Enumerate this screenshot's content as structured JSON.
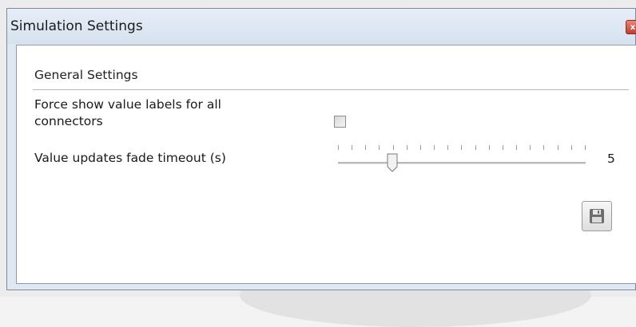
{
  "window": {
    "title": "Simulation Settings",
    "close_glyph": "x"
  },
  "settings": {
    "group_header": "General Settings",
    "force_labels": {
      "label": "Force show value labels for all connectors",
      "checked": false
    },
    "fade_timeout": {
      "label": "Value updates fade timeout (s)",
      "value": "5",
      "slider_fraction": 0.2,
      "tick_count": 19
    }
  },
  "icons": {
    "close": "close-icon",
    "save": "floppy-disk-icon"
  },
  "colors": {
    "titlebar": "#dfe8f2",
    "close_button": "#c13d2c",
    "client_background": "#ffffff"
  }
}
